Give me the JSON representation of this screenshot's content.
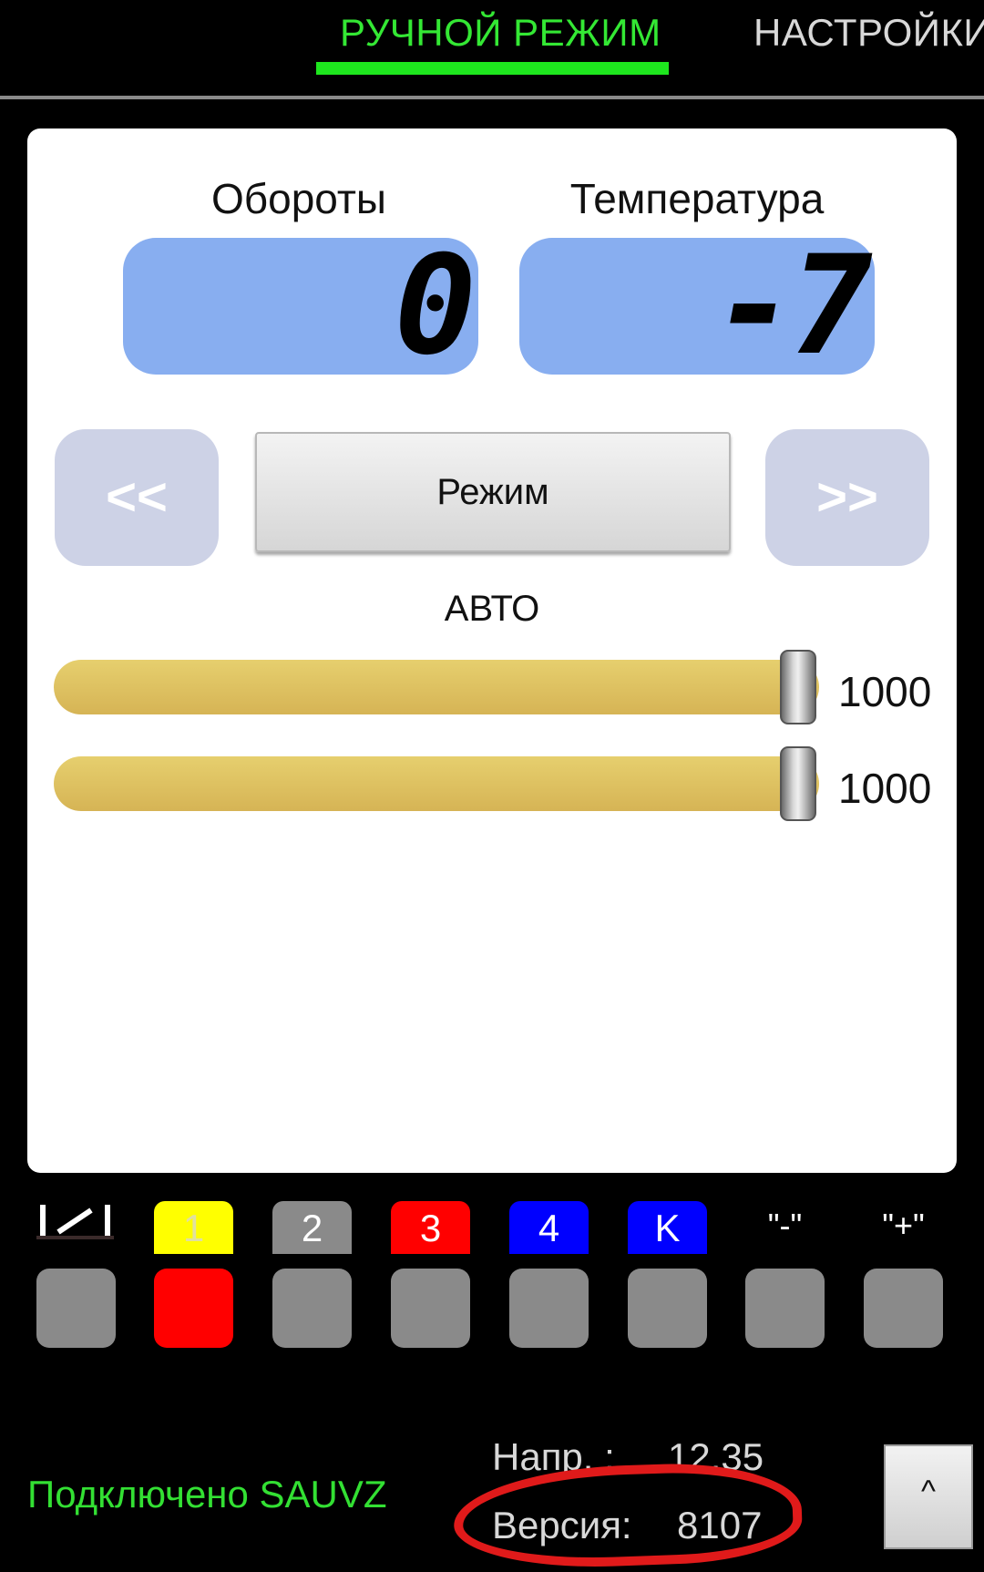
{
  "tabs": {
    "active": "РУЧНОЙ РЕЖИМ",
    "inactive": "НАСТРОЙКИ",
    "colors": {
      "active": "#34e834",
      "indicator": "#1ee61e"
    }
  },
  "gauges": {
    "rpm_label": "Обороты",
    "rpm_value": "0",
    "temp_label": "Температура",
    "temp_value": "-7"
  },
  "controls": {
    "prev_label": "<<",
    "next_label": ">>",
    "mode_button": "Режим",
    "mode_value": "АВТО"
  },
  "sliders": [
    {
      "value": "1000",
      "level": 1.0
    },
    {
      "value": "1000",
      "level": 1.0
    }
  ],
  "keys": {
    "indicator_icon": "toggle-indicator-icon",
    "top": [
      {
        "label": "1",
        "color": "#ffff00",
        "text_color": "#e0e0a0"
      },
      {
        "label": "2",
        "color": "#8a8a8a",
        "text_color": "#ffffff"
      },
      {
        "label": "3",
        "color": "#ff0000",
        "text_color": "#ffffff"
      },
      {
        "label": "4",
        "color": "#0000ff",
        "text_color": "#ffffff"
      },
      {
        "label": "K",
        "color": "#0000ff",
        "text_color": "#ffffff"
      }
    ],
    "minus_label": "\"-\"",
    "plus_label": "\"+\"",
    "bottom_colors": [
      "#8a8a8a",
      "#ff0000",
      "#8a8a8a",
      "#8a8a8a",
      "#8a8a8a",
      "#8a8a8a",
      "#8a8a8a",
      "#8a8a8a"
    ]
  },
  "footer": {
    "status": "Подключено SAUVZ",
    "voltage_label": "Напр. :",
    "voltage_value": "12.35",
    "version_label": "Версия:",
    "version_value": "8107",
    "up_button": "^"
  }
}
